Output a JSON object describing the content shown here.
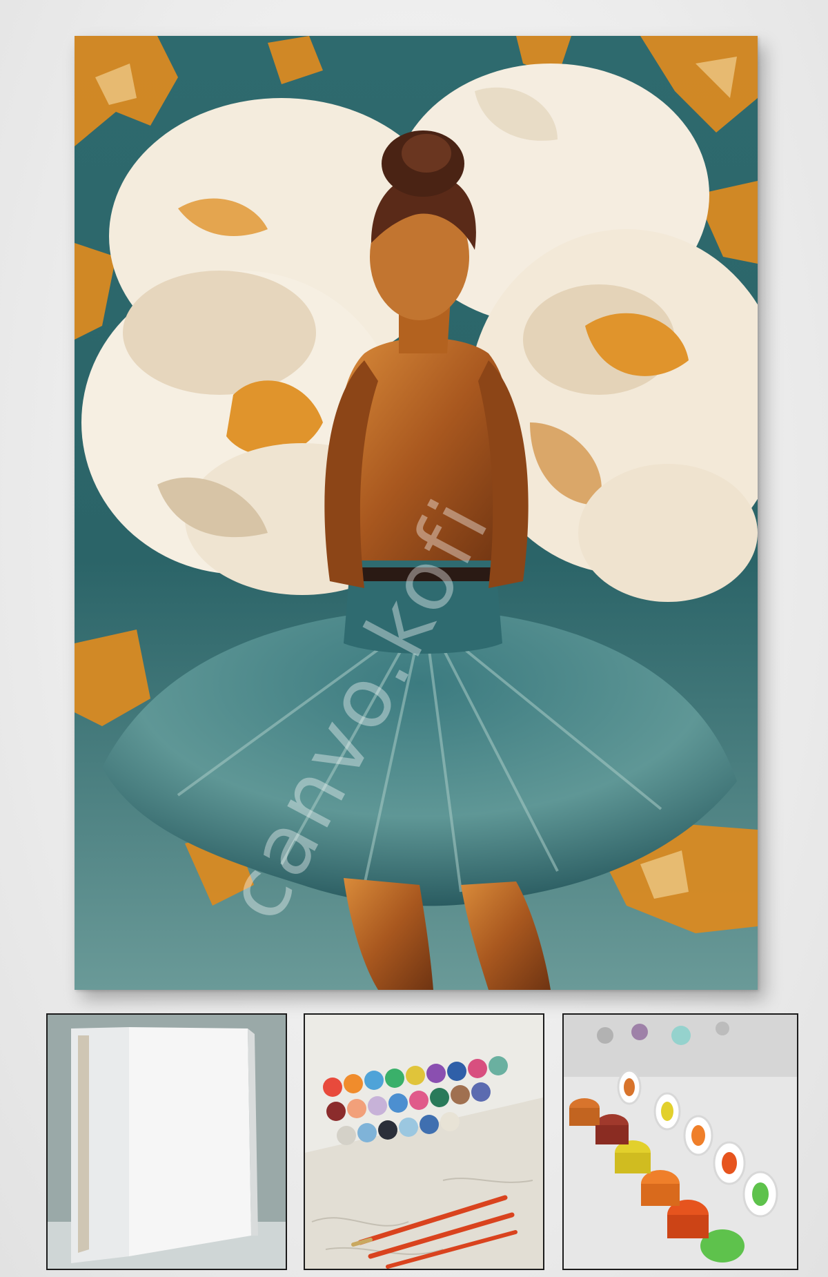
{
  "watermark": {
    "text": "canvo.kofi"
  },
  "painting": {
    "subject": "ballerina-with-peonies"
  },
  "thumbnails": [
    {
      "name": "blank-stretched-canvas"
    },
    {
      "name": "numbered-paint-pots-and-brushes"
    },
    {
      "name": "open-paint-pots"
    }
  ],
  "colors": {
    "teal_dark": "#1f4f55",
    "teal_mid": "#3f7f85",
    "teal_light": "#8fb5b2",
    "orange": "#d98a22",
    "cream": "#f4ecdd",
    "skin": "#a85a22",
    "hair": "#5a2a18"
  }
}
